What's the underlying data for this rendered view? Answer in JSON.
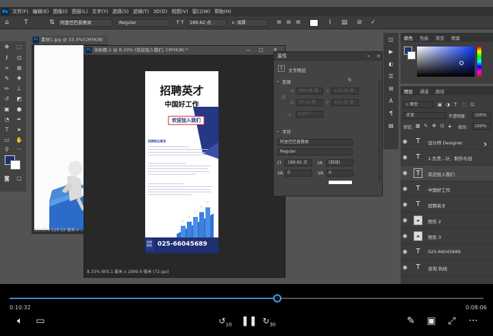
{
  "menubar": {
    "logo": "Ps",
    "items": [
      "文件(F)",
      "编辑(E)",
      "图像(I)",
      "图层(L)",
      "文字(Y)",
      "选择(S)",
      "滤镜(T)",
      "3D(D)",
      "视图(V)",
      "窗口(W)",
      "帮助(H)"
    ]
  },
  "options": {
    "font_family": "阿里巴巴普惠体",
    "font_style": "Regular",
    "font_size": "189.62 点",
    "antialias": "浑厚"
  },
  "doc1": {
    "tab_title": "素材1.jpg @ 33.3%(CMYK/8)",
    "status": "33.33%  129.52 毫米 x ..."
  },
  "doc2": {
    "tab_title": "未标题-1 @ 8.33% (欢迎加入我们, CMYK/8) *",
    "status": "8.33%  800.1 毫米 x 1999.9 毫米 (72 ppi)"
  },
  "poster": {
    "title": "招聘英才",
    "subtitle": "中国好工作",
    "banner": "欢迎加入我们",
    "section_title": "招聘岗位要求",
    "phone_label": "咨询\n热线",
    "phone": "025-66045689"
  },
  "properties": {
    "title": "属性",
    "layer_type": "文字图层",
    "transform_heading": "变换",
    "w_label": "W",
    "w_value": "784.96 毫",
    "x_label": "X",
    "x_value": "272.26 毫",
    "h_label": "H",
    "h_value": "70.92 毫",
    "y_label": "Y",
    "y_value": "525.01 毫",
    "angle_value": "0.00°",
    "char_heading": "字符",
    "font_family": "阿里巴巴普惠体",
    "font_style": "Regular",
    "font_size": "189.62 点",
    "leading": "(自动)",
    "kerning": "0",
    "tracking": "0"
  },
  "color_panel": {
    "tabs": [
      "颜色",
      "色板",
      "渐变",
      "图案"
    ],
    "foreground": "#1e2f75"
  },
  "layers_panel": {
    "tabs": [
      "图层",
      "通道",
      "路径"
    ],
    "filter_label": "类型",
    "blend_mode": "正常",
    "opacity_label": "不透明度:",
    "opacity": "100%",
    "lock_label": "锁定:",
    "fill_label": "填充:",
    "fill": "100%",
    "layers": [
      {
        "type": "text",
        "name": "设计师 Designer",
        "selected": false
      },
      {
        "type": "text",
        "name": "1.负责...计、制作与创",
        "selected": false
      },
      {
        "type": "text",
        "name": "欢迎加入我们",
        "selected": true
      },
      {
        "type": "text",
        "name": "中国好工作",
        "selected": false
      },
      {
        "type": "text",
        "name": "招聘英才",
        "selected": false
      },
      {
        "type": "shape",
        "name": "矩形 2",
        "selected": false
      },
      {
        "type": "shape",
        "name": "矩形 3",
        "selected": false
      },
      {
        "type": "text",
        "name": "025-66045689",
        "selected": false
      },
      {
        "type": "text",
        "name": "咨询 热线",
        "selected": false
      }
    ]
  },
  "player": {
    "current_time": "0:10:32",
    "total_time": "0:08:06",
    "progress": 0.565,
    "skip_back": "10",
    "skip_forward": "30"
  }
}
